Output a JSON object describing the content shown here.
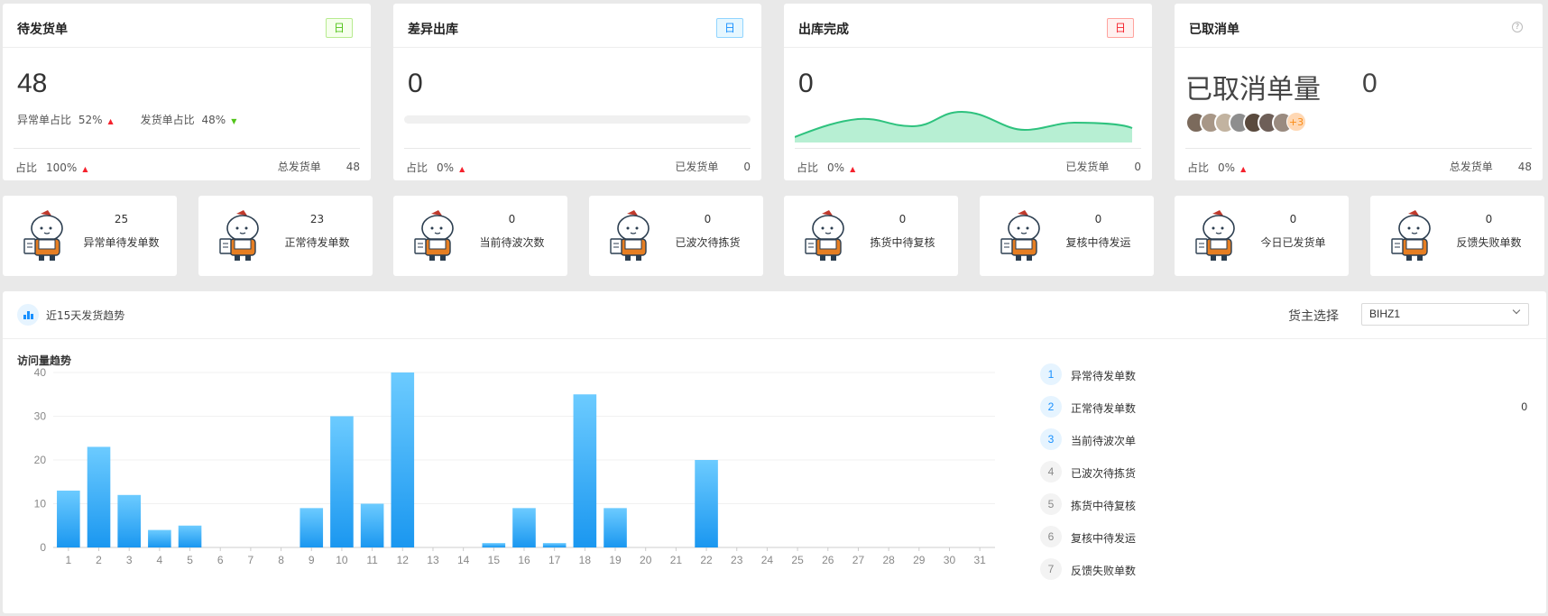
{
  "cards": [
    {
      "title": "待发货单",
      "tag": "日",
      "value": "48",
      "sub": [
        {
          "label": "异常单占比",
          "value": "52%",
          "trend": "up"
        },
        {
          "label": "发货单占比",
          "value": "48%",
          "trend": "down"
        }
      ],
      "foot_label": "占比",
      "foot_pct": "100%",
      "foot_right_label": "总发货单",
      "foot_right_value": "48"
    },
    {
      "title": "差异出库",
      "tag": "日",
      "value": "0",
      "progress": 0,
      "foot_label": "占比",
      "foot_pct": "0%",
      "foot_right_label": "已发货单",
      "foot_right_value": "0"
    },
    {
      "title": "出库完成",
      "tag": "日",
      "value": "0",
      "foot_label": "占比",
      "foot_pct": "0%",
      "foot_right_label": "已发货单",
      "foot_right_value": "0"
    },
    {
      "title": "已取消单",
      "label": "已取消单量",
      "value": "0",
      "more": "+3",
      "foot_label": "占比",
      "foot_pct": "0%",
      "foot_right_label": "总发货单",
      "foot_right_value": "48"
    }
  ],
  "tiles": [
    {
      "value": "25",
      "label": "异常单待发单数"
    },
    {
      "value": "23",
      "label": "正常待发单数"
    },
    {
      "value": "0",
      "label": "当前待波次数"
    },
    {
      "value": "0",
      "label": "已波次待拣货"
    },
    {
      "value": "0",
      "label": "拣货中待复核"
    },
    {
      "value": "0",
      "label": "复核中待发运"
    },
    {
      "value": "0",
      "label": "今日已发货单"
    },
    {
      "value": "0",
      "label": "反馈失败单数"
    }
  ],
  "panel": {
    "title": "近15天发货趋势",
    "owner_label": "货主选择",
    "owner_value": "BIHZ1"
  },
  "chart_data": {
    "type": "bar",
    "title": "访问量趋势",
    "categories": [
      "1",
      "2",
      "3",
      "4",
      "5",
      "6",
      "7",
      "8",
      "9",
      "10",
      "11",
      "12",
      "13",
      "14",
      "15",
      "16",
      "17",
      "18",
      "19",
      "20",
      "21",
      "22",
      "23",
      "24",
      "25",
      "26",
      "27",
      "28",
      "29",
      "30",
      "31"
    ],
    "values": [
      13,
      23,
      12,
      4,
      5,
      0,
      0,
      0,
      9,
      30,
      10,
      40,
      0,
      0,
      1,
      9,
      1,
      35,
      9,
      0,
      0,
      20,
      0,
      0,
      0,
      0,
      0,
      0,
      0,
      0,
      0
    ],
    "ylim": [
      0,
      40
    ],
    "yticks": [
      0,
      10,
      20,
      30,
      40
    ],
    "grid": true,
    "color": "#1890ff"
  },
  "ranking": [
    {
      "rank": "1",
      "label": "异常待发单数",
      "value": ""
    },
    {
      "rank": "2",
      "label": "正常待发单数",
      "value": "0"
    },
    {
      "rank": "3",
      "label": "当前待波次单",
      "value": ""
    },
    {
      "rank": "4",
      "label": "已波次待拣货",
      "value": ""
    },
    {
      "rank": "5",
      "label": "拣货中待复核",
      "value": ""
    },
    {
      "rank": "6",
      "label": "复核中待发运",
      "value": ""
    },
    {
      "rank": "7",
      "label": "反馈失败单数",
      "value": ""
    }
  ]
}
